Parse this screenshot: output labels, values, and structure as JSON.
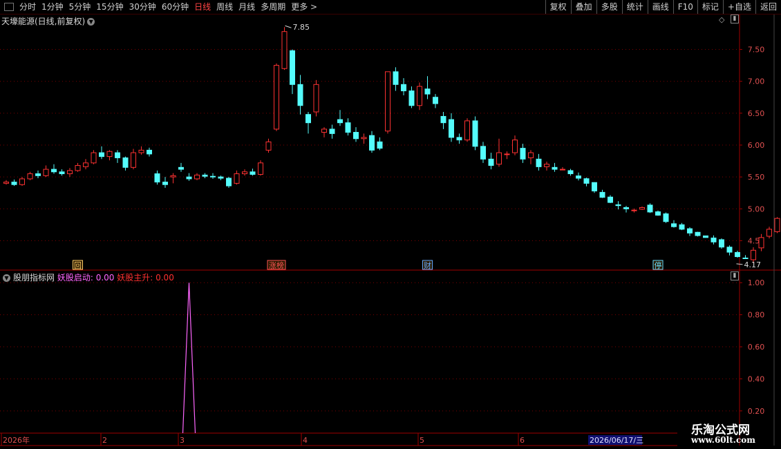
{
  "toolbar": {
    "periods": [
      "分时",
      "1分钟",
      "5分钟",
      "15分钟",
      "30分钟",
      "60分钟",
      "日线",
      "周线",
      "月线",
      "多周期",
      "更多 >"
    ],
    "active_index": 6,
    "buttons": [
      "复权",
      "叠加",
      "多股",
      "统计",
      "画线",
      "F10",
      "标记",
      "+自选",
      "返回"
    ]
  },
  "main": {
    "title": "天壕能源(日线,前复权)",
    "max_label": "7.85",
    "min_label": "4.17",
    "markers": [
      {
        "label": "回",
        "bar": 9,
        "color": "#ffcc66"
      },
      {
        "label": "涨榜",
        "bar": 34,
        "color": "#ff5555"
      },
      {
        "label": "财",
        "bar": 53,
        "color": "#66aaff"
      },
      {
        "label": "停",
        "bar": 82,
        "color": "#66ddff"
      }
    ]
  },
  "indicator": {
    "name": "股朋指标网",
    "line1": "妖股启动: 0.00",
    "line2": "妖股主升: 0.00"
  },
  "xaxis": {
    "labels": [
      {
        "text": "2026年",
        "bar": 0
      },
      {
        "text": "2",
        "bar": 14
      },
      {
        "text": "3",
        "bar": 24
      },
      {
        "text": "4",
        "bar": 41
      },
      {
        "text": "5",
        "bar": 57
      },
      {
        "text": "6",
        "bar": 70
      }
    ],
    "cursor_label": "2026/06/17/三"
  },
  "watermark": {
    "line1": "乐淘公式网",
    "line2": "www.60lt.com"
  },
  "colors": {
    "up": "#ff3232",
    "down": "#54fcfc",
    "grid": "#800000",
    "axis": "#a00000",
    "signal": "#ff66ff"
  },
  "chart_data": [
    {
      "type": "candlestick",
      "ylim": [
        4.05,
        7.95
      ],
      "yticks": [
        4.5,
        5.0,
        5.5,
        6.0,
        6.5,
        7.0,
        7.5
      ],
      "ohlc": [
        [
          5.4,
          5.45,
          5.38,
          5.42
        ],
        [
          5.42,
          5.46,
          5.36,
          5.38
        ],
        [
          5.38,
          5.5,
          5.36,
          5.47
        ],
        [
          5.47,
          5.58,
          5.45,
          5.55
        ],
        [
          5.55,
          5.6,
          5.48,
          5.52
        ],
        [
          5.52,
          5.68,
          5.5,
          5.62
        ],
        [
          5.62,
          5.7,
          5.55,
          5.58
        ],
        [
          5.58,
          5.62,
          5.52,
          5.55
        ],
        [
          5.55,
          5.64,
          5.5,
          5.6
        ],
        [
          5.6,
          5.72,
          5.58,
          5.68
        ],
        [
          5.66,
          5.78,
          5.62,
          5.72
        ],
        [
          5.72,
          5.92,
          5.7,
          5.88
        ],
        [
          5.88,
          5.98,
          5.78,
          5.82
        ],
        [
          5.82,
          5.92,
          5.76,
          5.9
        ],
        [
          5.88,
          5.92,
          5.72,
          5.8
        ],
        [
          5.8,
          5.82,
          5.6,
          5.65
        ],
        [
          5.65,
          5.94,
          5.62,
          5.88
        ],
        [
          5.88,
          5.98,
          5.85,
          5.92
        ],
        [
          5.92,
          5.96,
          5.82,
          5.86
        ],
        [
          5.55,
          5.6,
          5.38,
          5.42
        ],
        [
          5.42,
          5.5,
          5.33,
          5.38
        ],
        [
          5.5,
          5.56,
          5.4,
          5.52
        ],
        [
          5.65,
          5.72,
          5.58,
          5.62
        ],
        [
          5.5,
          5.56,
          5.44,
          5.47
        ],
        [
          5.47,
          5.56,
          5.45,
          5.53
        ],
        [
          5.53,
          5.56,
          5.48,
          5.51
        ],
        [
          5.51,
          5.56,
          5.47,
          5.5
        ],
        [
          5.5,
          5.52,
          5.45,
          5.48
        ],
        [
          5.48,
          5.5,
          5.33,
          5.36
        ],
        [
          5.4,
          5.6,
          5.38,
          5.55
        ],
        [
          5.55,
          5.62,
          5.52,
          5.58
        ],
        [
          5.58,
          5.63,
          5.52,
          5.54
        ],
        [
          5.54,
          5.76,
          5.52,
          5.72
        ],
        [
          5.92,
          6.1,
          5.88,
          6.05
        ],
        [
          6.25,
          7.28,
          6.22,
          7.25
        ],
        [
          7.2,
          7.85,
          7.18,
          7.78
        ],
        [
          7.48,
          7.5,
          6.8,
          6.95
        ],
        [
          6.95,
          7.1,
          6.48,
          6.62
        ],
        [
          6.48,
          6.52,
          6.18,
          6.35
        ],
        [
          6.52,
          7.02,
          6.45,
          6.95
        ],
        [
          6.2,
          6.28,
          6.12,
          6.25
        ],
        [
          6.25,
          6.32,
          6.1,
          6.18
        ],
        [
          6.4,
          6.55,
          6.3,
          6.35
        ],
        [
          6.35,
          6.42,
          6.15,
          6.2
        ],
        [
          6.2,
          6.28,
          6.05,
          6.1
        ],
        [
          6.1,
          6.18,
          6.02,
          6.12
        ],
        [
          6.15,
          6.22,
          5.88,
          5.92
        ],
        [
          6.05,
          6.12,
          5.92,
          5.95
        ],
        [
          6.22,
          7.15,
          6.18,
          7.15
        ],
        [
          7.15,
          7.22,
          6.85,
          6.95
        ],
        [
          6.95,
          7.05,
          6.78,
          6.85
        ],
        [
          6.85,
          6.92,
          6.58,
          6.62
        ],
        [
          6.62,
          6.98,
          6.55,
          6.92
        ],
        [
          6.88,
          7.08,
          6.72,
          6.8
        ],
        [
          6.75,
          6.8,
          6.58,
          6.65
        ],
        [
          6.45,
          6.52,
          6.25,
          6.35
        ],
        [
          6.4,
          6.5,
          6.05,
          6.12
        ],
        [
          6.12,
          6.18,
          6.02,
          6.08
        ],
        [
          6.08,
          6.42,
          6.05,
          6.38
        ],
        [
          6.38,
          6.45,
          5.92,
          5.98
        ],
        [
          5.98,
          6.05,
          5.72,
          5.78
        ],
        [
          5.78,
          5.88,
          5.62,
          5.68
        ],
        [
          5.7,
          6.1,
          5.66,
          5.88
        ],
        [
          5.85,
          5.9,
          5.78,
          5.86
        ],
        [
          5.88,
          6.15,
          5.84,
          6.08
        ],
        [
          5.95,
          6.02,
          5.72,
          5.78
        ],
        [
          5.8,
          5.92,
          5.7,
          5.88
        ],
        [
          5.78,
          5.86,
          5.6,
          5.66
        ],
        [
          5.66,
          5.74,
          5.6,
          5.7
        ],
        [
          5.65,
          5.72,
          5.58,
          5.62
        ]
      ]
    },
    {
      "type": "line",
      "name": "妖股启动",
      "ylim": [
        0.07,
        1.07
      ],
      "yticks": [
        0.2,
        0.4,
        0.6,
        0.8,
        1.0
      ],
      "bars": 115,
      "values_nonzero": [
        {
          "bar": 32,
          "value": 1.0
        }
      ]
    }
  ]
}
